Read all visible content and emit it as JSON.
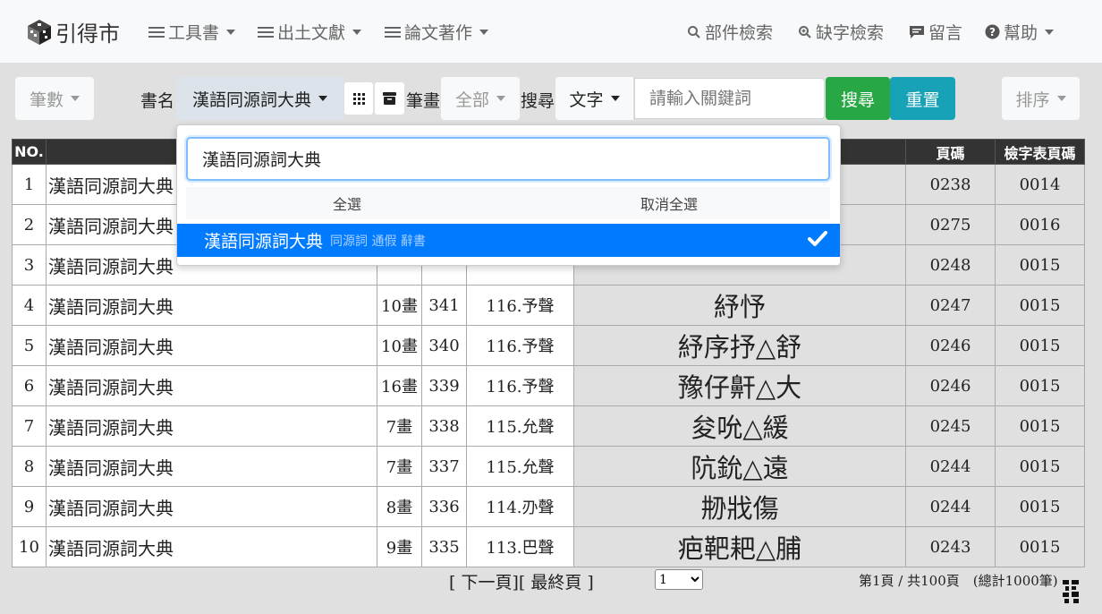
{
  "nav": {
    "brand": "引得市",
    "menus": [
      {
        "label": "工具書",
        "icon": "menu-icon"
      },
      {
        "label": "出土文獻",
        "icon": "menu-icon"
      },
      {
        "label": "論文著作",
        "icon": "menu-icon"
      }
    ],
    "links": [
      {
        "label": "部件檢索",
        "icon": "search-icon"
      },
      {
        "label": "缺字檢索",
        "icon": "search-plus-icon"
      },
      {
        "label": "留言",
        "icon": "comment-icon"
      },
      {
        "label": "幫助",
        "icon": "question-circle-icon"
      }
    ]
  },
  "filters": {
    "strokes_btn": "筆數",
    "book_label": "書名",
    "book_select": "漢語同源詞大典",
    "stroke_label": "筆畫",
    "stroke_select": "全部",
    "search_label": "搜尋",
    "search_type": "文字",
    "search_placeholder": "請輸入關鍵詞",
    "search_btn": "搜尋",
    "reset_btn": "重置",
    "sort_btn": "排序"
  },
  "dropdown": {
    "search_value": "漢語同源詞大典",
    "select_all": "全選",
    "deselect_all": "取消全選",
    "option_title": "漢語同源詞大典",
    "option_subtext": "同源詞 通假 辭書"
  },
  "table": {
    "headers": [
      "NO.",
      "",
      "",
      "",
      "",
      "",
      "頁碼",
      "檢字表頁碼"
    ],
    "rows": [
      {
        "no": "1",
        "book": "漢語同源詞大典",
        "strokes": "",
        "num": "",
        "group": "",
        "chars": "",
        "page": "0238",
        "index_page": "0014"
      },
      {
        "no": "2",
        "book": "漢語同源詞大典",
        "strokes": "",
        "num": "",
        "group": "",
        "chars": "",
        "page": "0275",
        "index_page": "0016"
      },
      {
        "no": "3",
        "book": "漢語同源詞大典",
        "strokes": "",
        "num": "",
        "group": "",
        "chars": "",
        "page": "0248",
        "index_page": "0015"
      },
      {
        "no": "4",
        "book": "漢語同源詞大典",
        "strokes": "10畫",
        "num": "341",
        "group": "116.予聲",
        "chars": "紓忬",
        "page": "0247",
        "index_page": "0015"
      },
      {
        "no": "5",
        "book": "漢語同源詞大典",
        "strokes": "10畫",
        "num": "340",
        "group": "116.予聲",
        "chars": "紓序抒△舒",
        "page": "0246",
        "index_page": "0015"
      },
      {
        "no": "6",
        "book": "漢語同源詞大典",
        "strokes": "16畫",
        "num": "339",
        "group": "116.予聲",
        "chars": "豫仔鼾△大",
        "page": "0246",
        "index_page": "0015"
      },
      {
        "no": "7",
        "book": "漢語同源詞大典",
        "strokes": "7畫",
        "num": "338",
        "group": "115.允聲",
        "chars": "夋吮△緩",
        "page": "0245",
        "index_page": "0015"
      },
      {
        "no": "8",
        "book": "漢語同源詞大典",
        "strokes": "7畫",
        "num": "337",
        "group": "115.允聲",
        "chars": "阬鈗△遠",
        "page": "0244",
        "index_page": "0015"
      },
      {
        "no": "9",
        "book": "漢語同源詞大典",
        "strokes": "8畫",
        "num": "336",
        "group": "114.刅聲",
        "chars": "刱戕傷",
        "page": "0244",
        "index_page": "0015"
      },
      {
        "no": "10",
        "book": "漢語同源詞大典",
        "strokes": "9畫",
        "num": "335",
        "group": "113.巴聲",
        "chars": "疤靶耙△脯",
        "page": "0243",
        "index_page": "0015"
      }
    ]
  },
  "pagination": {
    "next": "[ 下一頁]",
    "last": "[ 最終頁 ]",
    "page_select": "1",
    "info": "第1頁 / 共100頁　(總計1000筆)"
  }
}
